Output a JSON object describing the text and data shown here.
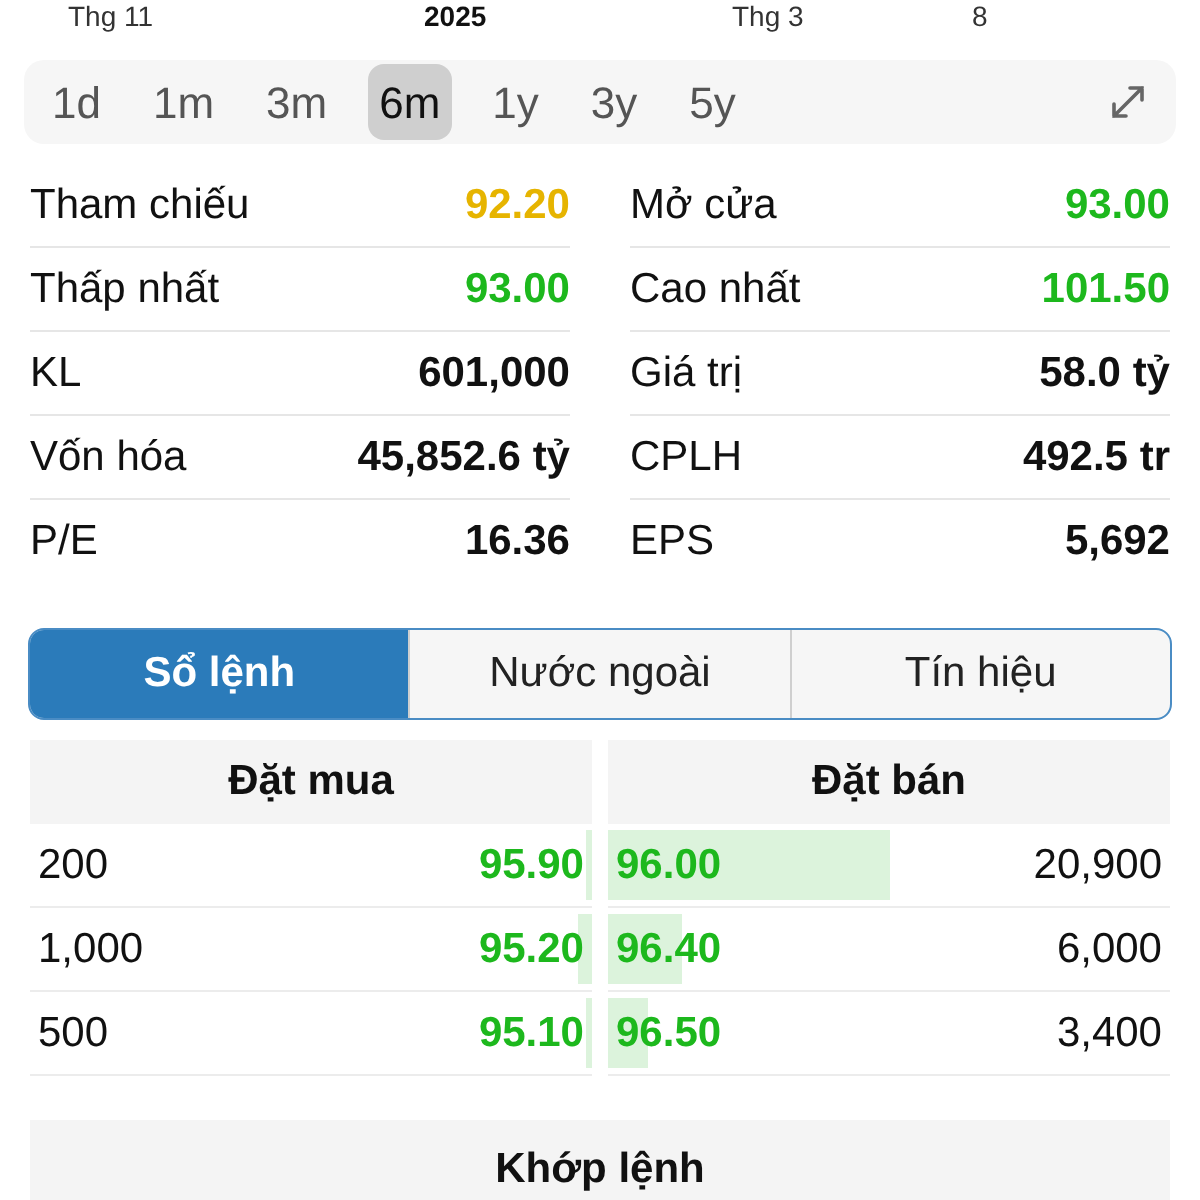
{
  "axis_labels": [
    {
      "text": "Thg 11",
      "kind": "month"
    },
    {
      "text": "2025",
      "kind": "year"
    },
    {
      "text": "Thg 3",
      "kind": "month"
    },
    {
      "text": "8",
      "kind": "month"
    }
  ],
  "periods": [
    {
      "label": "1d",
      "selected": false
    },
    {
      "label": "1m",
      "selected": false
    },
    {
      "label": "3m",
      "selected": false
    },
    {
      "label": "6m",
      "selected": true
    },
    {
      "label": "1y",
      "selected": false
    },
    {
      "label": "3y",
      "selected": false
    },
    {
      "label": "5y",
      "selected": false
    }
  ],
  "stats": [
    [
      {
        "label": "Tham chiếu",
        "value": "92.20",
        "color": "#e6b400"
      },
      {
        "label": "Mở cửa",
        "value": "93.00",
        "color": "#1db81d"
      }
    ],
    [
      {
        "label": "Thấp nhất",
        "value": "93.00",
        "color": "#1db81d"
      },
      {
        "label": "Cao nhất",
        "value": "101.50",
        "color": "#1db81d"
      }
    ],
    [
      {
        "label": "KL",
        "value": "601,000"
      },
      {
        "label": "Giá trị",
        "value": "58.0 tỷ"
      }
    ],
    [
      {
        "label": "Vốn hóa",
        "value": "45,852.6 tỷ"
      },
      {
        "label": "CPLH",
        "value": "492.5 tr"
      }
    ],
    [
      {
        "label": "P/E",
        "value": "16.36"
      },
      {
        "label": "EPS",
        "value": "5,692"
      }
    ]
  ],
  "tabs": [
    {
      "label": "Sổ lệnh",
      "selected": true
    },
    {
      "label": "Nước ngoài",
      "selected": false
    },
    {
      "label": "Tín hiệu",
      "selected": false
    }
  ],
  "order_book": {
    "buy_header": "Đặt mua",
    "sell_header": "Đặt bán",
    "rows": [
      {
        "buy_volume": "200",
        "buy_price": "95.90",
        "buy_bar": {
          "level": 0.01
        },
        "sell_price": "96.00",
        "sell_bar": {
          "level": 0.5
        },
        "sell_volume": "20,900"
      },
      {
        "buy_volume": "1,000",
        "buy_price": "95.20",
        "buy_bar": {
          "level": 0.025
        },
        "sell_price": "96.40",
        "sell_bar": {
          "level": 0.13
        },
        "sell_volume": "6,000"
      },
      {
        "buy_volume": "500",
        "buy_price": "95.10",
        "buy_bar": {
          "level": 0.01
        },
        "sell_price": "96.50",
        "sell_bar": {
          "level": 0.07
        },
        "sell_volume": "3,400"
      }
    ]
  },
  "matched_header": "Khớp lệnh"
}
